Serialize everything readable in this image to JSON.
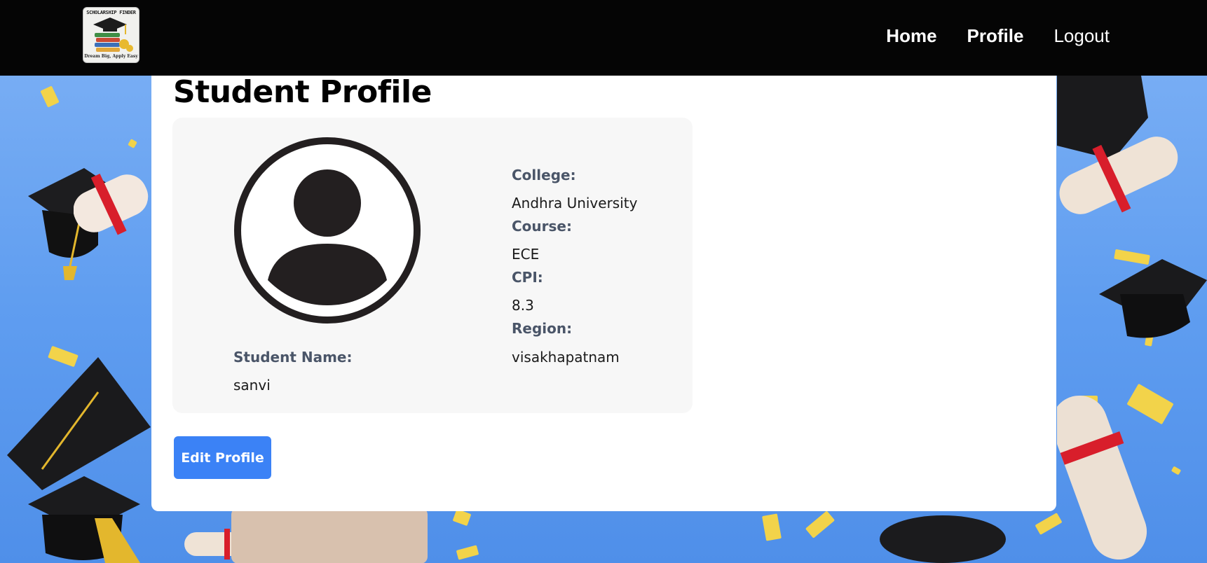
{
  "logo": {
    "top_text": "SCHOLARSHIP FINDER",
    "tagline": "Dream Big, Apply Easy"
  },
  "nav": {
    "items": [
      {
        "label": "Home"
      },
      {
        "label": "Profile"
      },
      {
        "label": "Logout"
      }
    ]
  },
  "page": {
    "title": "Student Profile"
  },
  "profile": {
    "name_label": "Student Name:",
    "name_value": "sanvi",
    "college_label": "College:",
    "college_value": "Andhra University",
    "course_label": "Course:",
    "course_value": "ECE",
    "cpi_label": "CPI:",
    "cpi_value": "8.3",
    "region_label": "Region:",
    "region_value": "visakhapatnam"
  },
  "actions": {
    "edit_label": "Edit Profile"
  },
  "colors": {
    "navbar": "#050505",
    "accent": "#3b82f6",
    "label": "#4a5568",
    "background": "#5f9df0"
  },
  "icons": {
    "avatar": "user-avatar-icon",
    "logo": "graduation-cap-books-icon"
  }
}
